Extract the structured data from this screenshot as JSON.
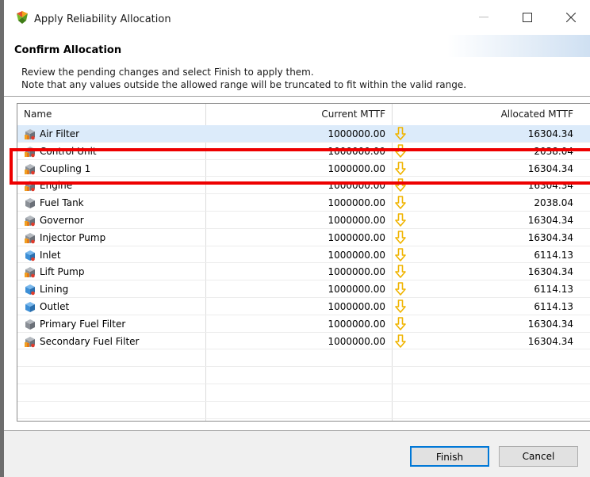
{
  "window": {
    "title": "Apply Reliability Allocation",
    "icon": "app-logo-icon",
    "controls": {
      "minimize": "minimize-icon",
      "maximize": "maximize-icon",
      "close": "close-icon"
    }
  },
  "header": {
    "title": "Confirm Allocation",
    "description_line1": "Review the pending changes and select Finish to apply them.",
    "description_line2": "Note that any values outside the allowed range will be truncated to fit within the valid range."
  },
  "table": {
    "columns": {
      "name": "Name",
      "current": "Current MTTF",
      "allocated": "Allocated MTTF"
    },
    "rows": [
      {
        "name": "Air Filter",
        "current": "1000000.00",
        "allocated": "16304.34",
        "icon": "component-block-icon",
        "selected": true
      },
      {
        "name": "Control Unit",
        "current": "1000000.00",
        "allocated": "2038.04",
        "icon": "component-block-icon"
      },
      {
        "name": "Coupling 1",
        "current": "1000000.00",
        "allocated": "16304.34",
        "icon": "component-block-icon"
      },
      {
        "name": "Engine",
        "current": "1000000.00",
        "allocated": "16304.34",
        "icon": "component-block-icon"
      },
      {
        "name": "Fuel Tank",
        "current": "1000000.00",
        "allocated": "2038.04",
        "icon": "component-gray-icon"
      },
      {
        "name": "Governor",
        "current": "1000000.00",
        "allocated": "16304.34",
        "icon": "component-block-icon"
      },
      {
        "name": "Injector Pump",
        "current": "1000000.00",
        "allocated": "16304.34",
        "icon": "component-block-icon"
      },
      {
        "name": "Inlet",
        "current": "1000000.00",
        "allocated": "6114.13",
        "icon": "component-blue-icon"
      },
      {
        "name": "Lift Pump",
        "current": "1000000.00",
        "allocated": "16304.34",
        "icon": "component-block-icon"
      },
      {
        "name": "Lining",
        "current": "1000000.00",
        "allocated": "6114.13",
        "icon": "component-blue-icon"
      },
      {
        "name": "Outlet",
        "current": "1000000.00",
        "allocated": "6114.13",
        "icon": "component-blue-plain-icon"
      },
      {
        "name": "Primary Fuel Filter",
        "current": "1000000.00",
        "allocated": "16304.34",
        "icon": "component-gray-icon"
      },
      {
        "name": "Secondary Fuel Filter",
        "current": "1000000.00",
        "allocated": "16304.34",
        "icon": "component-block-icon"
      }
    ],
    "arrow_icon": "decrease-arrow-icon"
  },
  "buttons": {
    "finish": "Finish",
    "cancel": "Cancel"
  },
  "colors": {
    "selection": "#dcebfa",
    "highlight_box": "#ee0000",
    "arrow": "#f0b400",
    "finish_border": "#0078d7"
  }
}
